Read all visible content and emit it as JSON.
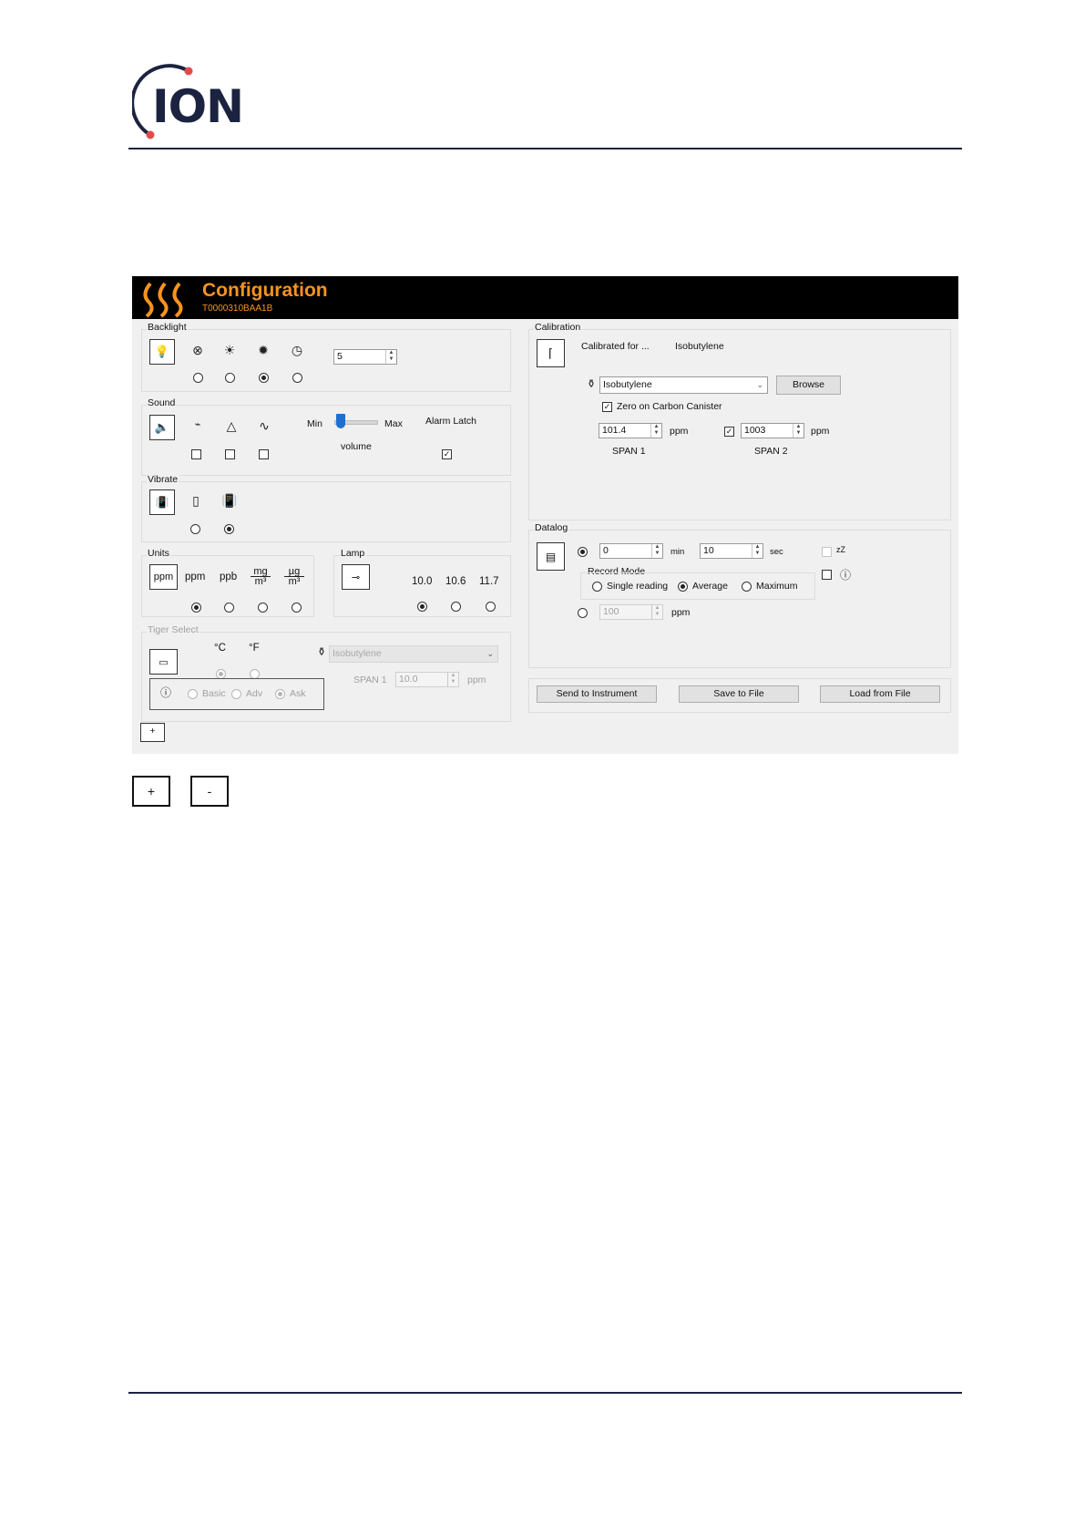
{
  "logo": {
    "text": "ION"
  },
  "window": {
    "title": "Configuration",
    "serial": "T0000310BAA1B",
    "accent_color": "#f7941d"
  },
  "backlight": {
    "label": "Backlight",
    "icons": [
      "bulb-icon",
      "bulb-off-icon",
      "bulb-on-icon",
      "sun-icon",
      "timer-icon"
    ],
    "selected_index": 2,
    "timeout_value": "5"
  },
  "sound": {
    "label": "Sound",
    "min_label": "Min",
    "max_label": "Max",
    "volume_label": "volume",
    "volume_level": 0.05,
    "alarm_latch_label": "Alarm Latch",
    "alarm_latch_checked": true
  },
  "vibrate": {
    "label": "Vibrate",
    "selected_index": 1
  },
  "units": {
    "label": "Units",
    "ppm": "ppm",
    "ppb": "ppb",
    "mg_num": "mg",
    "mg_den": "m³",
    "ug_num": "µg",
    "ug_den": "m³",
    "box_label": "ppm",
    "selected_index": 0
  },
  "lamp": {
    "label": "Lamp",
    "options": [
      "10.0",
      "10.6",
      "11.7"
    ],
    "selected_index": 0
  },
  "tiger": {
    "label": "Tiger Select",
    "celsius": "°C",
    "fahrenheit": "°F",
    "gas": "Isobutylene",
    "basic": "Basic",
    "adv": "Adv",
    "ask": "Ask",
    "span_label": "SPAN 1",
    "span_value": "10.0",
    "ppm": "ppm"
  },
  "calibration": {
    "label": "Calibration",
    "calibrated_for_label": "Calibrated for ...",
    "calibrated_for_value": "Isobutylene",
    "gas_select": "Isobutylene",
    "browse": "Browse",
    "zero_label": "Zero on Carbon Canister",
    "zero_checked": true,
    "span1_value": "101.4",
    "span1_unit": "ppm",
    "span1_label": "SPAN 1",
    "span2_checked": true,
    "span2_value": "1003",
    "span2_unit": "ppm",
    "span2_label": "SPAN 2"
  },
  "datalog": {
    "label": "Datalog",
    "min_value": "0",
    "min_unit": "min",
    "sec_value": "10",
    "sec_unit": "sec",
    "sleep_label": "zZ",
    "record_mode_label": "Record Mode",
    "single": "Single reading",
    "average": "Average",
    "maximum": "Maximum",
    "selected_mode": "average",
    "threshold_value": "100",
    "threshold_unit": "ppm"
  },
  "actions": {
    "send": "Send to Instrument",
    "save": "Save to File",
    "load": "Load from File",
    "expand": "+"
  },
  "zoom": {
    "plus": "+",
    "minus": "-"
  }
}
